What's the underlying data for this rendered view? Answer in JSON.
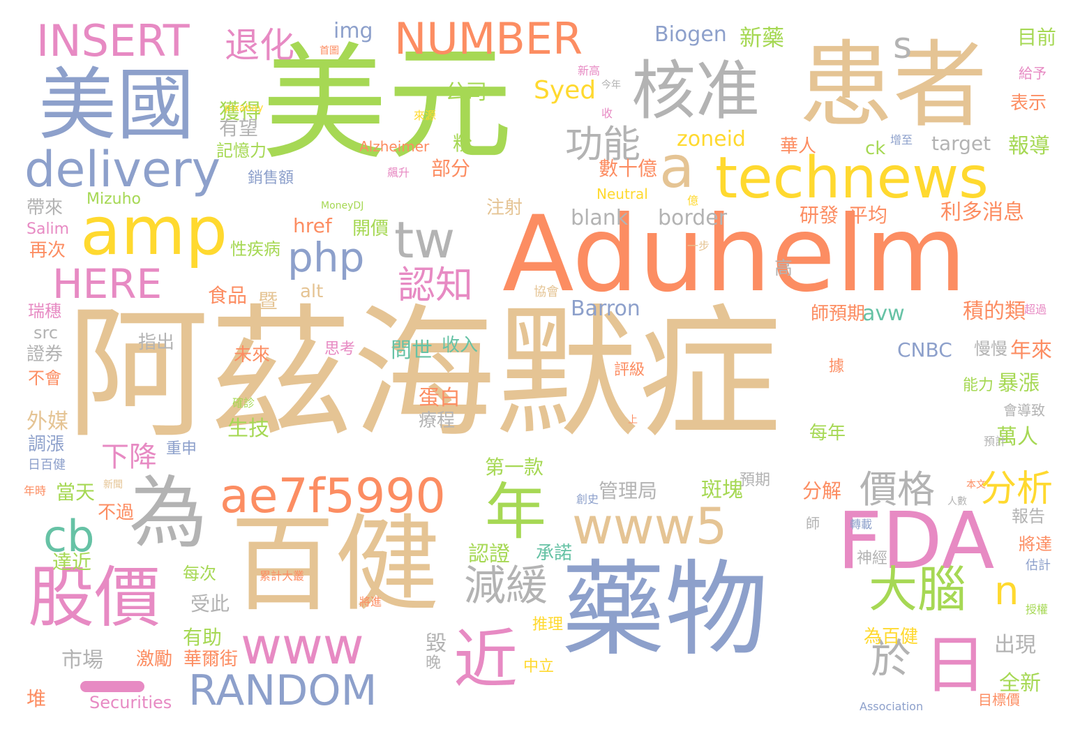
{
  "colors": {
    "background": "#ffffff",
    "palette": [
      "#66c2a5",
      "#fc8d62",
      "#8da0cb",
      "#e78ac3",
      "#a6d854",
      "#ffd92f",
      "#e5c494",
      "#b3b3b3"
    ]
  },
  "words": [
    "阿茲海默症",
    "美元",
    "患者",
    "美國",
    "Aduhelm",
    "藥物",
    "百健",
    "核准",
    "technews",
    "amp",
    "a",
    "為",
    "FDA",
    "INSERT",
    "NUMBER",
    "delivery",
    "tw",
    "php",
    "www5",
    "ae7f5990",
    "年",
    "股價",
    "www",
    "近",
    "日",
    "RANDOM",
    "HERE",
    "cb",
    "大腦",
    "減緩",
    "功能",
    "認知",
    "退化",
    "s",
    "價格",
    "分析",
    "於",
    "n",
    "Syed",
    "Biogen",
    "新藥",
    "img",
    "目前",
    "zoneid",
    "target",
    "公司",
    "獲得",
    "有望",
    "記憶力",
    "粉",
    "部分",
    "數十億",
    "blank",
    "border",
    "研發",
    "平均",
    "利多消息",
    "href",
    "開價",
    "注射",
    "Mizuho",
    "帶來",
    "Salim",
    "再次",
    "alt",
    "食品",
    "暨",
    "Barron",
    "avw",
    "積的類",
    "師預期",
    "src",
    "指出",
    "證券",
    "未來",
    "思考",
    "問世",
    "收入",
    "CNBC",
    "慢慢",
    "年來",
    "不會",
    "外媒",
    "調漲",
    "生技",
    "蛋白",
    "療程",
    "暴漲",
    "萬人",
    "下降",
    "第一款",
    "管理局",
    "斑塊",
    "分解",
    "當天",
    "不過",
    "預期",
    "達近",
    "認證",
    "承諾",
    "報告",
    "將達",
    "每次",
    "受此",
    "有助",
    "激勵",
    "華爾街",
    "推理",
    "出現",
    "市場",
    "中立",
    "全新",
    "堆",
    "Securities",
    "目標價",
    "為百健",
    "毀",
    "每年",
    "高",
    "神經",
    "Alzheimer",
    "Neutral",
    "MoneyDJ",
    "pixabay",
    "給予",
    "表示",
    "報導",
    "增至",
    "ck",
    "華人",
    "飆升",
    "銷售額",
    "協會",
    "一步",
    "性疾病",
    "瑞穗",
    "評級",
    "確診",
    "上",
    "預計",
    "能力",
    "會導致",
    "超過",
    "據",
    "日百健",
    "重申",
    "新聞",
    "年時",
    "創史",
    "人數",
    "本文",
    "轉載",
    "估計",
    "授權",
    "累計大叢",
    "將進",
    "Association",
    "晚",
    "首圖",
    "新高",
    "今年",
    "收",
    "來源",
    "億",
    "師"
  ]
}
